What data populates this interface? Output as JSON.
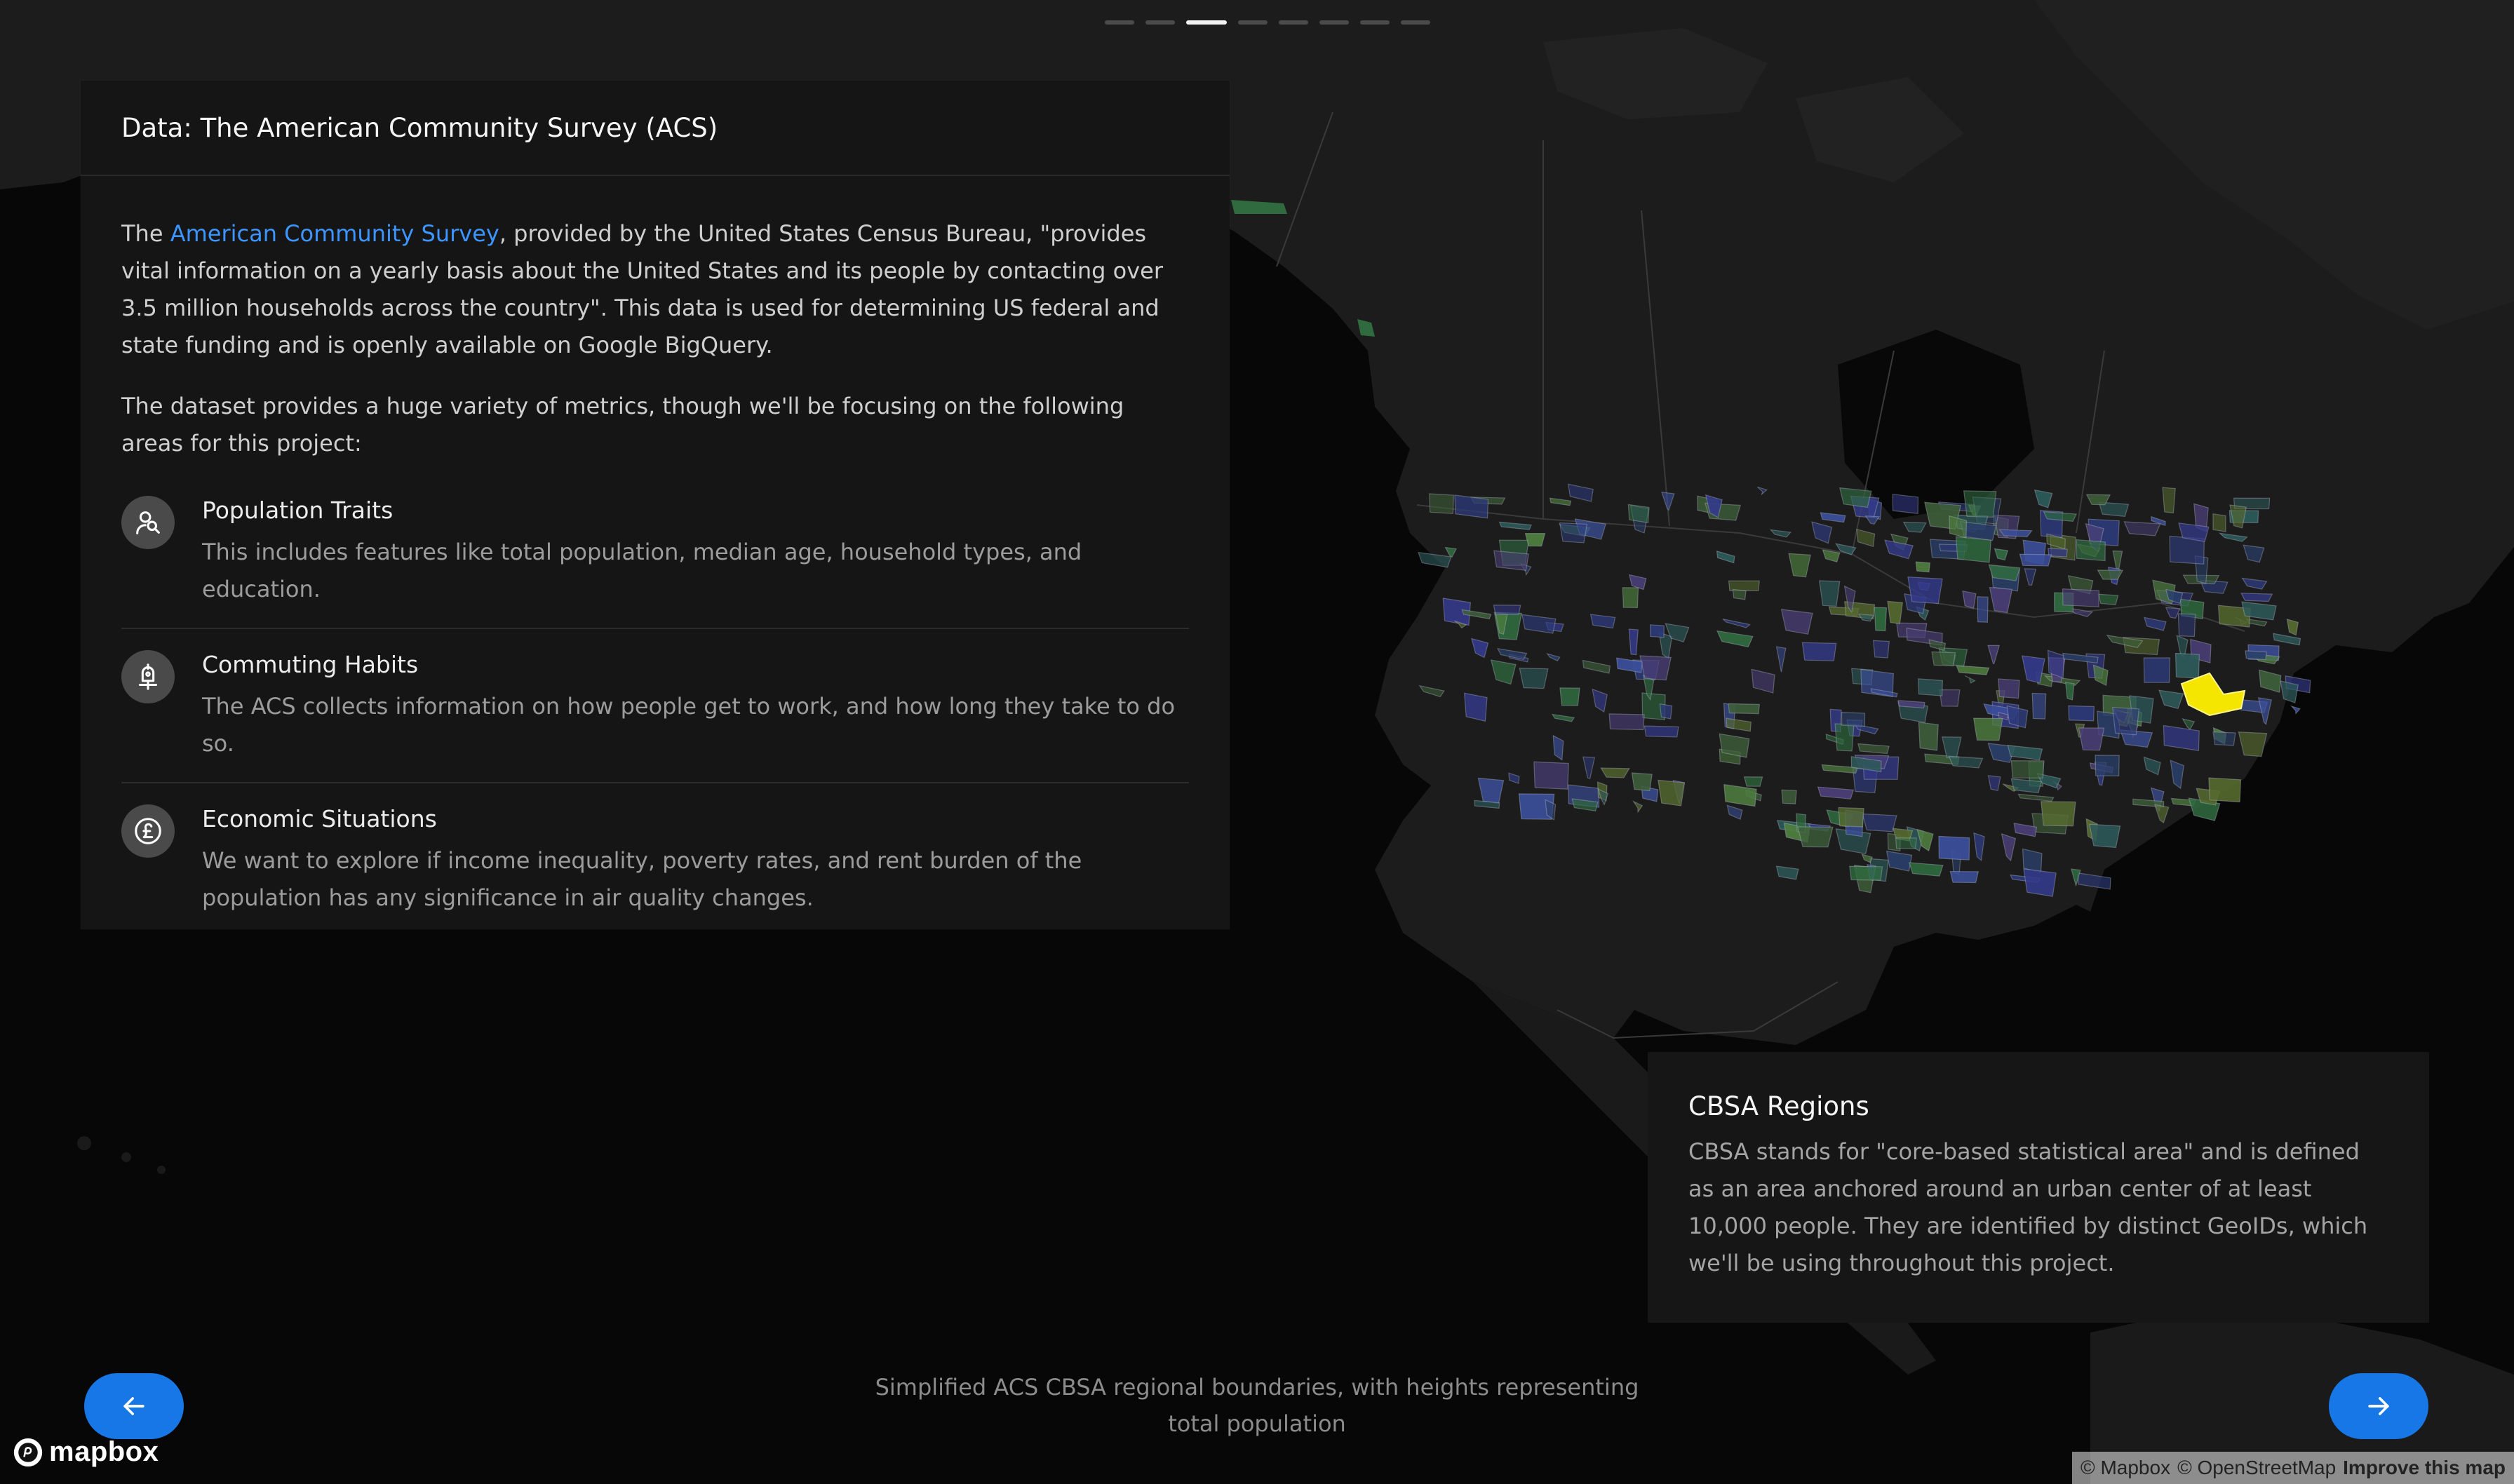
{
  "map": {
    "provider": "mapbox",
    "style": "dark",
    "highlight_color": "#f5e600",
    "region_colors": [
      "#2f6b3f",
      "#3b4f9b",
      "#4f7f3f",
      "#2d3a7a",
      "#3e5f3a",
      "#2a3f6a",
      "#566b2f",
      "#2d5a5a",
      "#343a8a",
      "#4b3f78"
    ]
  },
  "progress": {
    "total": 8,
    "current": 3
  },
  "info_panel": {
    "title": "Data: The American Community Survey (ACS)",
    "para1_pre": "The ",
    "para1_link": "American Community Survey",
    "para1_post": ", provided by the United States Census Bureau, \"provides vital information on a yearly basis about the United States and its people by contacting over 3.5 million households across the country\". This data is used for determining US federal and state funding and is openly available on Google BigQuery.",
    "para2": "The dataset provides a huge variety of metrics, though we'll be focusing on the following areas for this project:",
    "features": [
      {
        "icon": "population-icon",
        "title": "Population Traits",
        "description": "This includes features like total population, median age, household types, and education."
      },
      {
        "icon": "commute-icon",
        "title": "Commuting Habits",
        "description": "The ACS collects information on how people get to work, and how long they take to do so."
      },
      {
        "icon": "pound-coin-icon",
        "title": "Economic Situations",
        "description": "We want to explore if income inequality, poverty rates, and rent burden of the population has any significance in air quality changes."
      }
    ]
  },
  "cbsa_card": {
    "title": "CBSA Regions",
    "description": "CBSA stands for \"core-based statistical area\" and is defined as an area anchored around an urban center of at least 10,000 people. They are identified by distinct GeoIDs, which we'll be using throughout this project."
  },
  "caption": "Simplified ACS CBSA regional boundaries, with heights representing total population",
  "nav": {
    "prev_icon": "arrow-left-icon",
    "next_icon": "arrow-right-icon",
    "accent": "#1877e6"
  },
  "logo": {
    "text": "mapbox"
  },
  "attribution": {
    "mapbox": "© Mapbox",
    "osm": "© OpenStreetMap",
    "improve": "Improve this map"
  }
}
